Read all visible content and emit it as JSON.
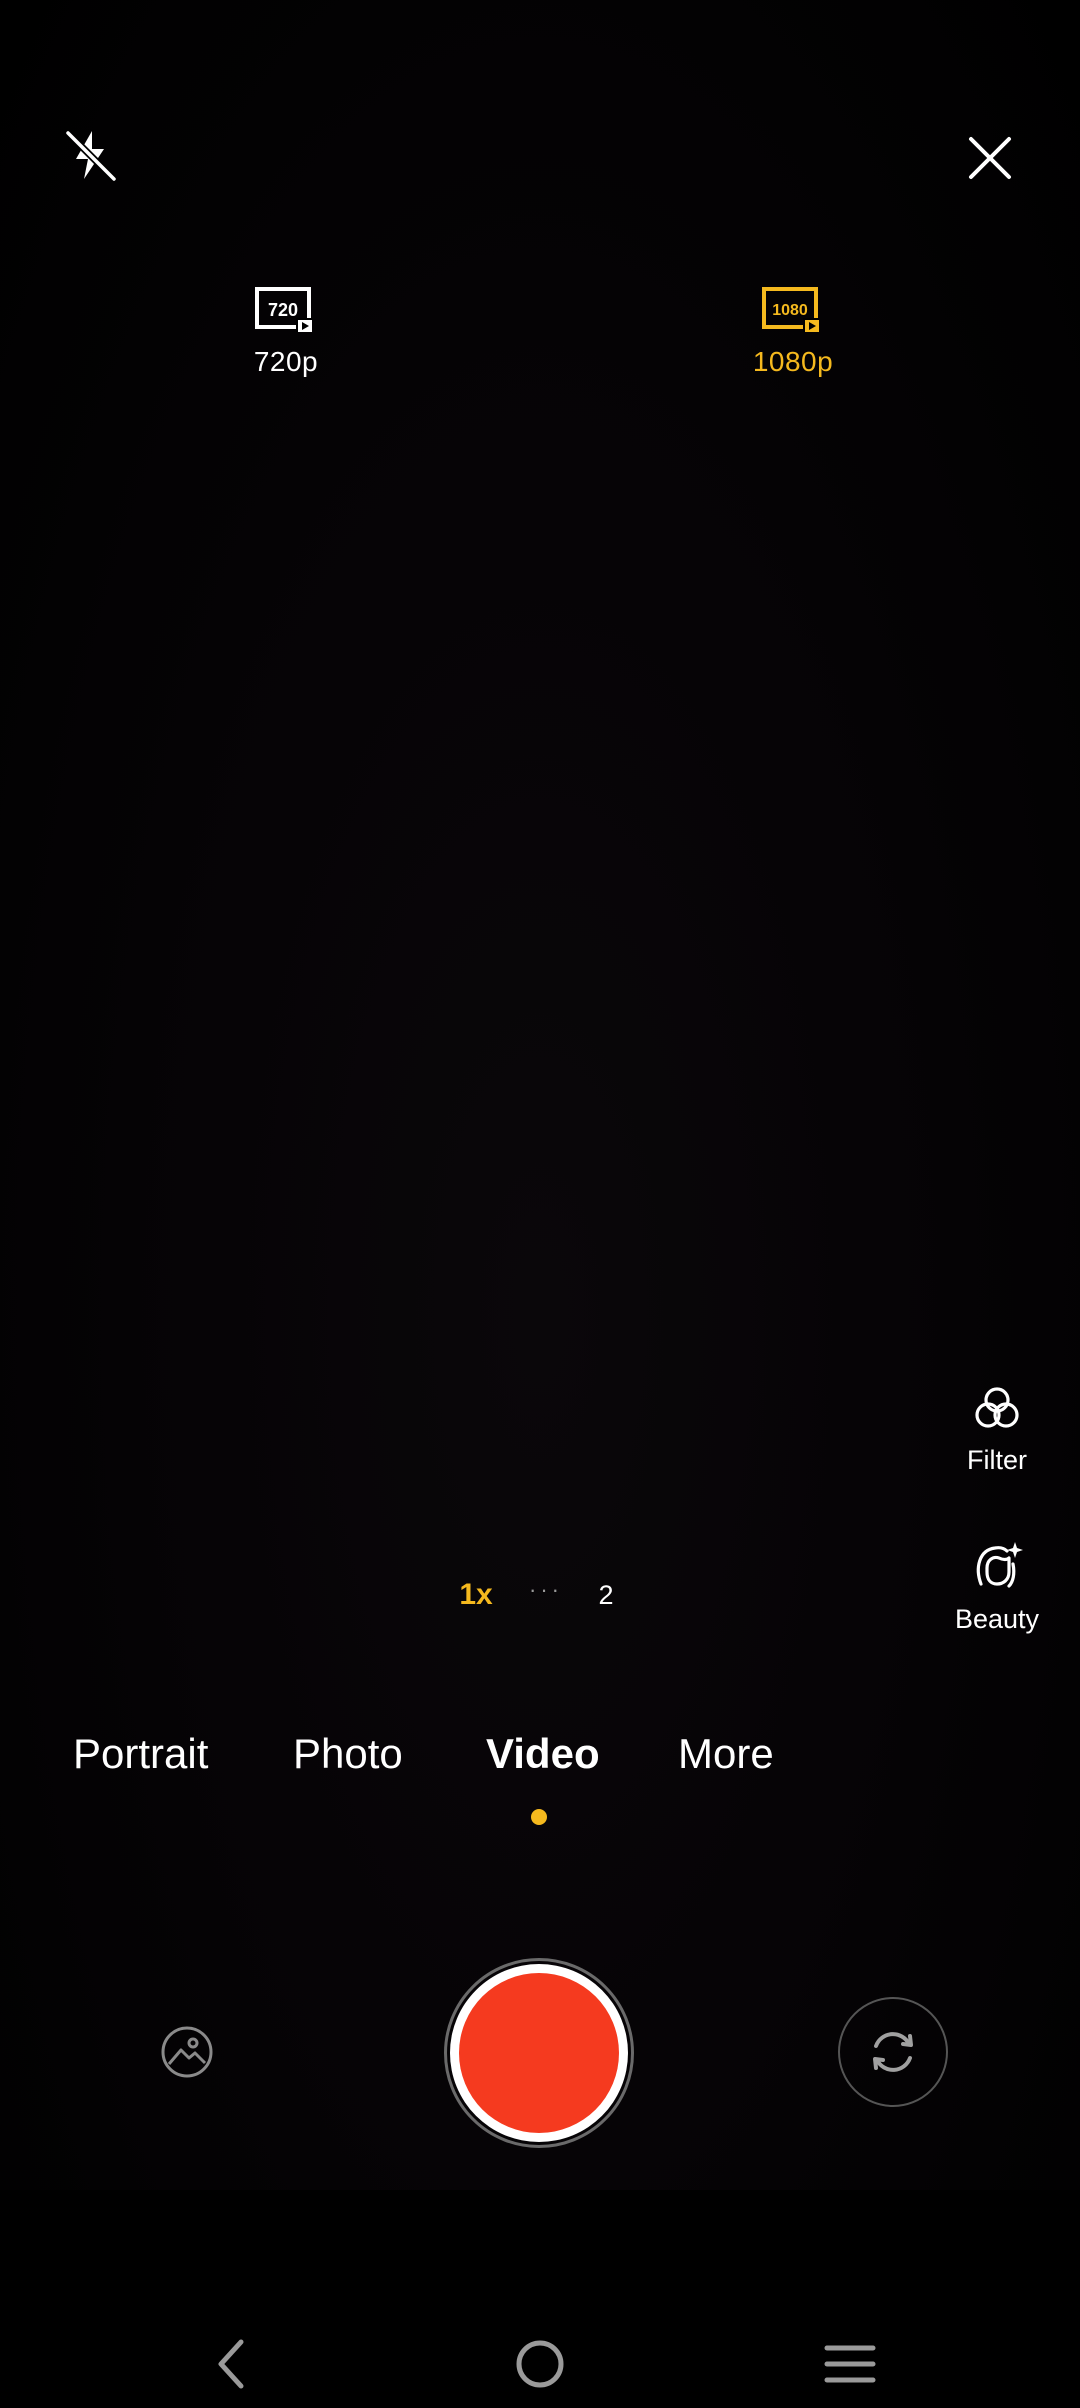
{
  "top_bar": {
    "flash_icon": "flash-off-icon",
    "close_icon": "close-icon"
  },
  "resolution": {
    "options": [
      {
        "icon_text": "720",
        "label": "720p",
        "selected": false
      },
      {
        "icon_text": "1080",
        "label": "1080p",
        "selected": true
      }
    ],
    "selected_color": "#f5b91e"
  },
  "side_tools": {
    "filter": {
      "label": "Filter",
      "icon": "filter-icon"
    },
    "beauty": {
      "label": "Beauty",
      "icon": "beauty-icon"
    }
  },
  "zoom": {
    "active": "1x",
    "dots": "···",
    "other": "2"
  },
  "modes": {
    "items": [
      {
        "label": "Portrait",
        "active": false
      },
      {
        "label": "Photo",
        "active": false
      },
      {
        "label": "Video",
        "active": true
      },
      {
        "label": "More",
        "active": false
      }
    ]
  },
  "controls": {
    "gallery_icon": "gallery-icon",
    "shutter_color": "#f53a1f",
    "flip_icon": "flip-camera-icon"
  },
  "navbar": {
    "back_icon": "back-icon",
    "home_icon": "home-icon",
    "menu_icon": "menu-icon"
  }
}
